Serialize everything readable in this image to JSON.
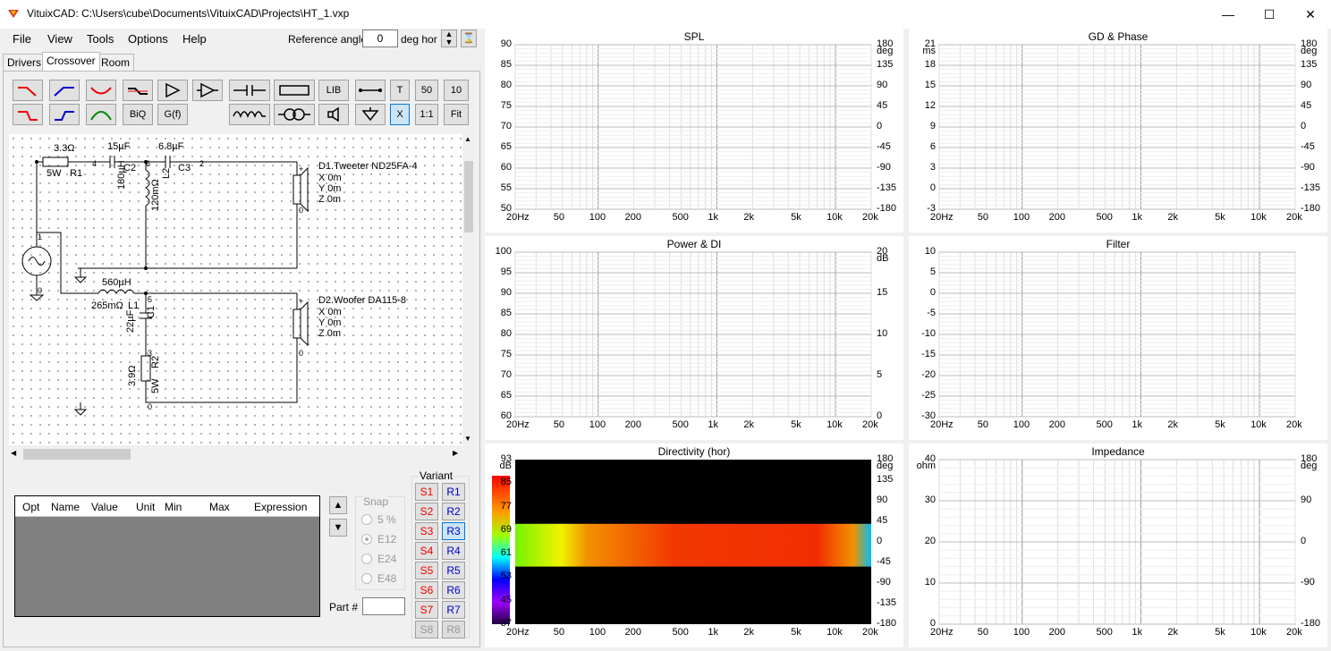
{
  "window": {
    "title": "VituixCAD: C:\\Users\\cube\\Documents\\VituixCAD\\Projects\\HT_1.vxp"
  },
  "menu": [
    "File",
    "View",
    "Tools",
    "Options",
    "Help"
  ],
  "reference": {
    "label": "Reference angle",
    "value": "0",
    "unit": "deg hor"
  },
  "tabs": [
    "Drivers",
    "Crossover",
    "Room"
  ],
  "toolbar": {
    "lib": "LIB",
    "t": "T",
    "n50": "50",
    "n10": "10",
    "biq": "BiQ",
    "gf": "G(f)",
    "x": "X",
    "oneone": "1:1",
    "fit": "Fit"
  },
  "schematic": {
    "r1": {
      "value": "3.3Ω",
      "power": "5W",
      "name": "R1"
    },
    "c2": {
      "value": "15µF",
      "name": "C2"
    },
    "c3": {
      "value": "6.8µF",
      "name": "C3"
    },
    "l2": {
      "value": "180µH",
      "res": "120mΩ",
      "name": "L2"
    },
    "l1": {
      "value": "560µH",
      "res": "265mΩ",
      "name": "L1"
    },
    "c1": {
      "value": "22µF",
      "name": "C1"
    },
    "r2": {
      "value": "3.9Ω",
      "power": "5W",
      "name": "R2"
    },
    "d1": {
      "name": "D1.Tweeter ND25FA-4",
      "x": "X 0m",
      "y": "Y 0m",
      "z": "Z 0m"
    },
    "d2": {
      "name": "D2.Woofer DA115-8",
      "x": "X 0m",
      "y": "Y 0m",
      "z": "Z 0m"
    },
    "nodes": [
      "4",
      "6",
      "2",
      "1",
      "0",
      "5",
      "3",
      "0",
      "0",
      "0",
      "+",
      "+"
    ]
  },
  "optgrid": {
    "columns": [
      "Opt",
      "Name",
      "Value",
      "Unit",
      "Min",
      "Max",
      "Expression"
    ]
  },
  "snap": {
    "label": "Snap",
    "options": [
      "5 %",
      "E12",
      "E24",
      "E48"
    ],
    "selected": "E12"
  },
  "part": {
    "label": "Part #",
    "value": ""
  },
  "variant": {
    "label": "Variant",
    "s": [
      "S1",
      "S2",
      "S3",
      "S4",
      "S5",
      "S6",
      "S7",
      "S8"
    ],
    "r": [
      "R1",
      "R2",
      "R3",
      "R4",
      "R5",
      "R6",
      "R7",
      "R8"
    ],
    "selected": "R3"
  },
  "charts": {
    "spl": {
      "title": "SPL",
      "yleft": [
        "90",
        "85",
        "80",
        "75",
        "70",
        "65",
        "60",
        "55",
        "50"
      ],
      "yright": [
        "180",
        "deg",
        "135",
        "90",
        "45",
        "0",
        "-45",
        "-90",
        "-135",
        "-180"
      ],
      "xticks": [
        "20Hz",
        "50",
        "100",
        "200",
        "500",
        "1k",
        "2k",
        "5k",
        "10k",
        "20k"
      ]
    },
    "gd": {
      "title": "GD & Phase",
      "yleft": [
        "21",
        "ms",
        "18",
        "15",
        "12",
        "9",
        "6",
        "3",
        "0",
        "-3"
      ],
      "yright": [
        "180",
        "deg",
        "135",
        "90",
        "45",
        "0",
        "-45",
        "-90",
        "-135",
        "-180"
      ],
      "xticks": [
        "20Hz",
        "50",
        "100",
        "200",
        "500",
        "1k",
        "2k",
        "5k",
        "10k",
        "20k"
      ]
    },
    "power": {
      "title": "Power & DI",
      "yleft": [
        "100",
        "95",
        "90",
        "85",
        "80",
        "75",
        "70",
        "65",
        "60"
      ],
      "yright": [
        "20",
        "dB",
        "15",
        "10",
        "5",
        "0"
      ],
      "xticks": [
        "20Hz",
        "50",
        "100",
        "200",
        "500",
        "1k",
        "2k",
        "5k",
        "10k",
        "20k"
      ]
    },
    "filter": {
      "title": "Filter",
      "yleft": [
        "10",
        "5",
        "0",
        "-5",
        "-10",
        "-15",
        "-20",
        "-25",
        "-30"
      ],
      "xticks": [
        "20Hz",
        "50",
        "100",
        "200",
        "500",
        "1k",
        "2k",
        "5k",
        "10k",
        "20k"
      ]
    },
    "directivity": {
      "title": "Directivity (hor)",
      "yleft": [
        "93",
        "dB",
        "85",
        "77",
        "69",
        "61",
        "53",
        "45",
        "37"
      ],
      "yright": [
        "180",
        "deg",
        "135",
        "90",
        "45",
        "0",
        "-45",
        "-90",
        "-135",
        "-180"
      ],
      "xticks": [
        "20Hz",
        "50",
        "100",
        "200",
        "500",
        "1k",
        "2k",
        "5k",
        "10k",
        "20k"
      ]
    },
    "impedance": {
      "title": "Impedance",
      "yleft": [
        "40",
        "ohm",
        "30",
        "20",
        "10",
        "0"
      ],
      "yright": [
        "180",
        "deg",
        "90",
        "0",
        "-90",
        "-180"
      ],
      "xticks": [
        "20Hz",
        "50",
        "100",
        "200",
        "500",
        "1k",
        "2k",
        "5k",
        "10k",
        "20k"
      ]
    }
  }
}
